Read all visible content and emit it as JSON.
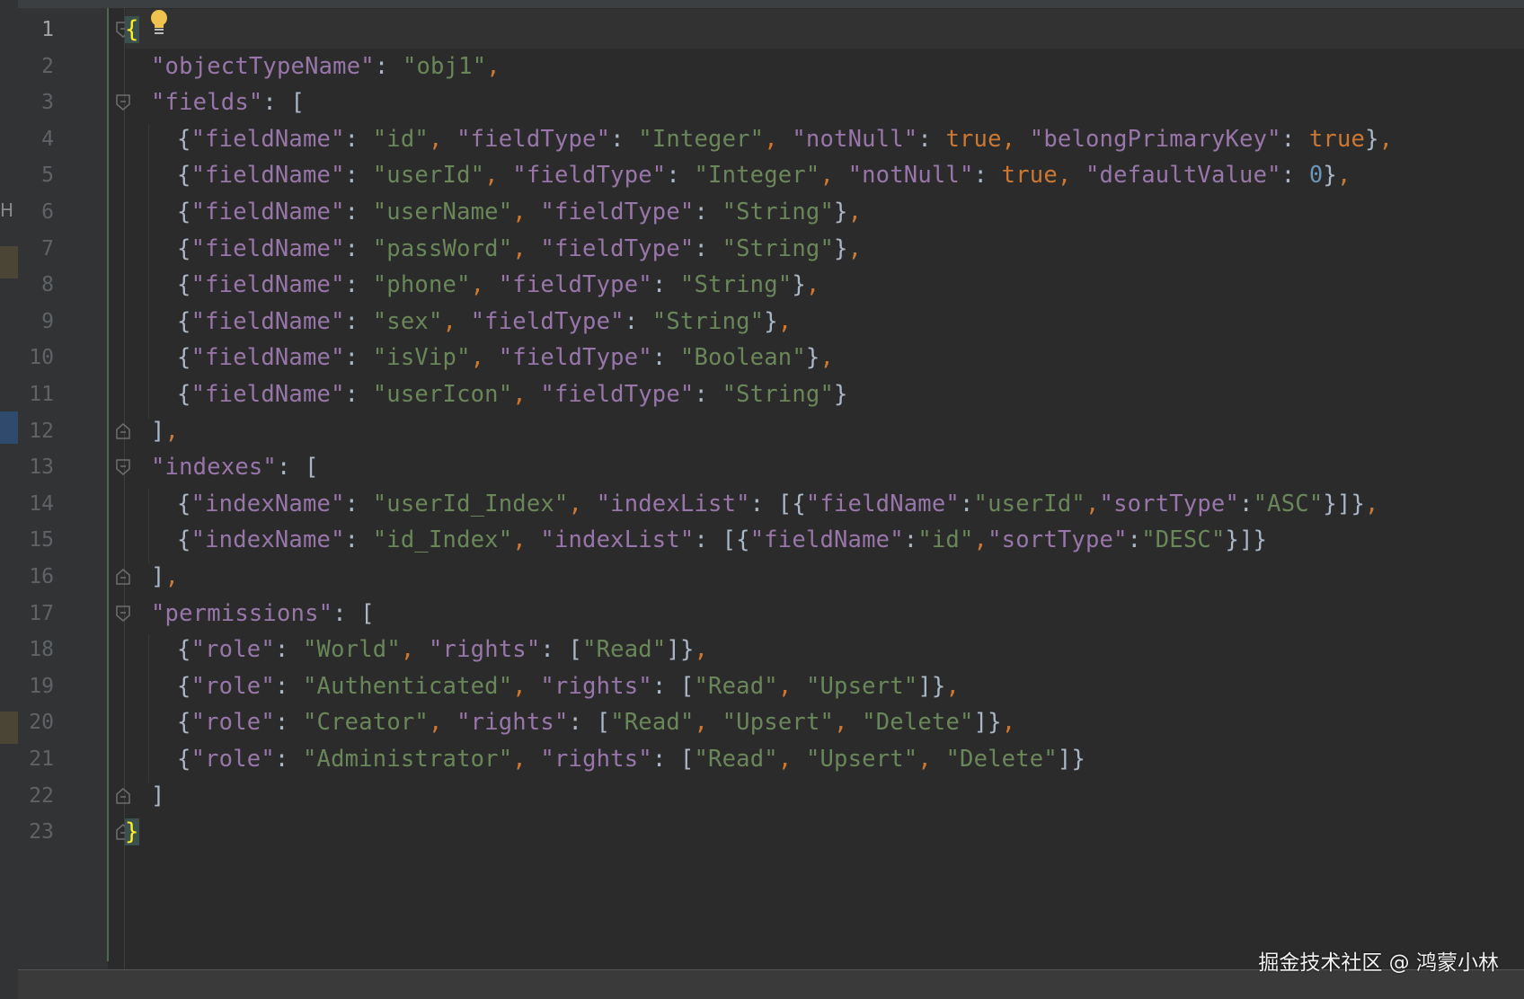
{
  "editor": {
    "language": "json",
    "active_line": 1,
    "side_strip_text": "H",
    "lines": [
      {
        "n": "1",
        "tokens": [
          {
            "t": "{",
            "c": "brace-hl"
          }
        ]
      },
      {
        "n": "2",
        "tokens": [
          {
            "t": "\"objectTypeName\"",
            "c": "key"
          },
          {
            "t": ": ",
            "c": "p"
          },
          {
            "t": "\"obj1\"",
            "c": "str"
          },
          {
            "t": ",",
            "c": "kw"
          }
        ]
      },
      {
        "n": "3",
        "tokens": [
          {
            "t": "\"fields\"",
            "c": "key"
          },
          {
            "t": ": [",
            "c": "p"
          }
        ]
      },
      {
        "n": "4",
        "tokens": [
          {
            "t": "{",
            "c": "p"
          },
          {
            "t": "\"fieldName\"",
            "c": "key"
          },
          {
            "t": ": ",
            "c": "p"
          },
          {
            "t": "\"id\"",
            "c": "str"
          },
          {
            "t": ", ",
            "c": "kw"
          },
          {
            "t": "\"fieldType\"",
            "c": "key"
          },
          {
            "t": ": ",
            "c": "p"
          },
          {
            "t": "\"Integer\"",
            "c": "str"
          },
          {
            "t": ", ",
            "c": "kw"
          },
          {
            "t": "\"notNull\"",
            "c": "key"
          },
          {
            "t": ": ",
            "c": "p"
          },
          {
            "t": "true",
            "c": "kw"
          },
          {
            "t": ", ",
            "c": "kw"
          },
          {
            "t": "\"belongPrimaryKey\"",
            "c": "key"
          },
          {
            "t": ": ",
            "c": "p"
          },
          {
            "t": "true",
            "c": "kw"
          },
          {
            "t": "}",
            "c": "p"
          },
          {
            "t": ",",
            "c": "kw"
          }
        ]
      },
      {
        "n": "5",
        "tokens": [
          {
            "t": "{",
            "c": "p"
          },
          {
            "t": "\"fieldName\"",
            "c": "key"
          },
          {
            "t": ": ",
            "c": "p"
          },
          {
            "t": "\"userId\"",
            "c": "str"
          },
          {
            "t": ", ",
            "c": "kw"
          },
          {
            "t": "\"fieldType\"",
            "c": "key"
          },
          {
            "t": ": ",
            "c": "p"
          },
          {
            "t": "\"Integer\"",
            "c": "str"
          },
          {
            "t": ", ",
            "c": "kw"
          },
          {
            "t": "\"notNull\"",
            "c": "key"
          },
          {
            "t": ": ",
            "c": "p"
          },
          {
            "t": "true",
            "c": "kw"
          },
          {
            "t": ", ",
            "c": "kw"
          },
          {
            "t": "\"defaultValue\"",
            "c": "key"
          },
          {
            "t": ": ",
            "c": "p"
          },
          {
            "t": "0",
            "c": "num"
          },
          {
            "t": "}",
            "c": "p"
          },
          {
            "t": ",",
            "c": "kw"
          }
        ]
      },
      {
        "n": "6",
        "tokens": [
          {
            "t": "{",
            "c": "p"
          },
          {
            "t": "\"fieldName\"",
            "c": "key"
          },
          {
            "t": ": ",
            "c": "p"
          },
          {
            "t": "\"userName\"",
            "c": "str"
          },
          {
            "t": ", ",
            "c": "kw"
          },
          {
            "t": "\"fieldType\"",
            "c": "key"
          },
          {
            "t": ": ",
            "c": "p"
          },
          {
            "t": "\"String\"",
            "c": "str"
          },
          {
            "t": "}",
            "c": "p"
          },
          {
            "t": ",",
            "c": "kw"
          }
        ]
      },
      {
        "n": "7",
        "tokens": [
          {
            "t": "{",
            "c": "p"
          },
          {
            "t": "\"fieldName\"",
            "c": "key"
          },
          {
            "t": ": ",
            "c": "p"
          },
          {
            "t": "\"passWord\"",
            "c": "str"
          },
          {
            "t": ", ",
            "c": "kw"
          },
          {
            "t": "\"fieldType\"",
            "c": "key"
          },
          {
            "t": ": ",
            "c": "p"
          },
          {
            "t": "\"String\"",
            "c": "str"
          },
          {
            "t": "}",
            "c": "p"
          },
          {
            "t": ",",
            "c": "kw"
          }
        ]
      },
      {
        "n": "8",
        "tokens": [
          {
            "t": "{",
            "c": "p"
          },
          {
            "t": "\"fieldName\"",
            "c": "key"
          },
          {
            "t": ": ",
            "c": "p"
          },
          {
            "t": "\"phone\"",
            "c": "str"
          },
          {
            "t": ", ",
            "c": "kw"
          },
          {
            "t": "\"fieldType\"",
            "c": "key"
          },
          {
            "t": ": ",
            "c": "p"
          },
          {
            "t": "\"String\"",
            "c": "str"
          },
          {
            "t": "}",
            "c": "p"
          },
          {
            "t": ",",
            "c": "kw"
          }
        ]
      },
      {
        "n": "9",
        "tokens": [
          {
            "t": "{",
            "c": "p"
          },
          {
            "t": "\"fieldName\"",
            "c": "key"
          },
          {
            "t": ": ",
            "c": "p"
          },
          {
            "t": "\"sex\"",
            "c": "str"
          },
          {
            "t": ", ",
            "c": "kw"
          },
          {
            "t": "\"fieldType\"",
            "c": "key"
          },
          {
            "t": ": ",
            "c": "p"
          },
          {
            "t": "\"String\"",
            "c": "str"
          },
          {
            "t": "}",
            "c": "p"
          },
          {
            "t": ",",
            "c": "kw"
          }
        ]
      },
      {
        "n": "10",
        "tokens": [
          {
            "t": "{",
            "c": "p"
          },
          {
            "t": "\"fieldName\"",
            "c": "key"
          },
          {
            "t": ": ",
            "c": "p"
          },
          {
            "t": "\"isVip\"",
            "c": "str"
          },
          {
            "t": ", ",
            "c": "kw"
          },
          {
            "t": "\"fieldType\"",
            "c": "key"
          },
          {
            "t": ": ",
            "c": "p"
          },
          {
            "t": "\"Boolean\"",
            "c": "str"
          },
          {
            "t": "}",
            "c": "p"
          },
          {
            "t": ",",
            "c": "kw"
          }
        ]
      },
      {
        "n": "11",
        "tokens": [
          {
            "t": "{",
            "c": "p"
          },
          {
            "t": "\"fieldName\"",
            "c": "key"
          },
          {
            "t": ": ",
            "c": "p"
          },
          {
            "t": "\"userIcon\"",
            "c": "str"
          },
          {
            "t": ", ",
            "c": "kw"
          },
          {
            "t": "\"fieldType\"",
            "c": "key"
          },
          {
            "t": ": ",
            "c": "p"
          },
          {
            "t": "\"String\"",
            "c": "str"
          },
          {
            "t": "}",
            "c": "p"
          }
        ]
      },
      {
        "n": "12",
        "tokens": [
          {
            "t": "]",
            "c": "p"
          },
          {
            "t": ",",
            "c": "kw"
          }
        ]
      },
      {
        "n": "13",
        "tokens": [
          {
            "t": "\"indexes\"",
            "c": "key"
          },
          {
            "t": ": [",
            "c": "p"
          }
        ]
      },
      {
        "n": "14",
        "tokens": [
          {
            "t": "{",
            "c": "p"
          },
          {
            "t": "\"indexName\"",
            "c": "key"
          },
          {
            "t": ": ",
            "c": "p"
          },
          {
            "t": "\"userId_Index\"",
            "c": "str"
          },
          {
            "t": ", ",
            "c": "kw"
          },
          {
            "t": "\"indexList\"",
            "c": "key"
          },
          {
            "t": ": [{",
            "c": "p"
          },
          {
            "t": "\"fieldName\"",
            "c": "key"
          },
          {
            "t": ":",
            "c": "p"
          },
          {
            "t": "\"userId\"",
            "c": "str"
          },
          {
            "t": ",",
            "c": "kw"
          },
          {
            "t": "\"sortType\"",
            "c": "key"
          },
          {
            "t": ":",
            "c": "p"
          },
          {
            "t": "\"ASC\"",
            "c": "str"
          },
          {
            "t": "}]}",
            "c": "p"
          },
          {
            "t": ",",
            "c": "kw"
          }
        ]
      },
      {
        "n": "15",
        "tokens": [
          {
            "t": "{",
            "c": "p"
          },
          {
            "t": "\"indexName\"",
            "c": "key"
          },
          {
            "t": ": ",
            "c": "p"
          },
          {
            "t": "\"id_Index\"",
            "c": "str"
          },
          {
            "t": ", ",
            "c": "kw"
          },
          {
            "t": "\"indexList\"",
            "c": "key"
          },
          {
            "t": ": [{",
            "c": "p"
          },
          {
            "t": "\"fieldName\"",
            "c": "key"
          },
          {
            "t": ":",
            "c": "p"
          },
          {
            "t": "\"id\"",
            "c": "str"
          },
          {
            "t": ",",
            "c": "kw"
          },
          {
            "t": "\"sortType\"",
            "c": "key"
          },
          {
            "t": ":",
            "c": "p"
          },
          {
            "t": "\"DESC\"",
            "c": "str"
          },
          {
            "t": "}]}",
            "c": "p"
          }
        ]
      },
      {
        "n": "16",
        "tokens": [
          {
            "t": "]",
            "c": "p"
          },
          {
            "t": ",",
            "c": "kw"
          }
        ]
      },
      {
        "n": "17",
        "tokens": [
          {
            "t": "\"permissions\"",
            "c": "key"
          },
          {
            "t": ": [",
            "c": "p"
          }
        ]
      },
      {
        "n": "18",
        "tokens": [
          {
            "t": "{",
            "c": "p"
          },
          {
            "t": "\"role\"",
            "c": "key"
          },
          {
            "t": ": ",
            "c": "p"
          },
          {
            "t": "\"World\"",
            "c": "str"
          },
          {
            "t": ", ",
            "c": "kw"
          },
          {
            "t": "\"rights\"",
            "c": "key"
          },
          {
            "t": ": [",
            "c": "p"
          },
          {
            "t": "\"Read\"",
            "c": "str"
          },
          {
            "t": "]}",
            "c": "p"
          },
          {
            "t": ",",
            "c": "kw"
          }
        ]
      },
      {
        "n": "19",
        "tokens": [
          {
            "t": "{",
            "c": "p"
          },
          {
            "t": "\"role\"",
            "c": "key"
          },
          {
            "t": ": ",
            "c": "p"
          },
          {
            "t": "\"Authenticated\"",
            "c": "str"
          },
          {
            "t": ", ",
            "c": "kw"
          },
          {
            "t": "\"rights\"",
            "c": "key"
          },
          {
            "t": ": [",
            "c": "p"
          },
          {
            "t": "\"Read\"",
            "c": "str"
          },
          {
            "t": ", ",
            "c": "kw"
          },
          {
            "t": "\"Upsert\"",
            "c": "str"
          },
          {
            "t": "]}",
            "c": "p"
          },
          {
            "t": ",",
            "c": "kw"
          }
        ]
      },
      {
        "n": "20",
        "tokens": [
          {
            "t": "{",
            "c": "p"
          },
          {
            "t": "\"role\"",
            "c": "key"
          },
          {
            "t": ": ",
            "c": "p"
          },
          {
            "t": "\"Creator\"",
            "c": "str"
          },
          {
            "t": ", ",
            "c": "kw"
          },
          {
            "t": "\"rights\"",
            "c": "key"
          },
          {
            "t": ": [",
            "c": "p"
          },
          {
            "t": "\"Read\"",
            "c": "str"
          },
          {
            "t": ", ",
            "c": "kw"
          },
          {
            "t": "\"Upsert\"",
            "c": "str"
          },
          {
            "t": ", ",
            "c": "kw"
          },
          {
            "t": "\"Delete\"",
            "c": "str"
          },
          {
            "t": "]}",
            "c": "p"
          },
          {
            "t": ",",
            "c": "kw"
          }
        ]
      },
      {
        "n": "21",
        "tokens": [
          {
            "t": "{",
            "c": "p"
          },
          {
            "t": "\"role\"",
            "c": "key"
          },
          {
            "t": ": ",
            "c": "p"
          },
          {
            "t": "\"Administrator\"",
            "c": "str"
          },
          {
            "t": ", ",
            "c": "kw"
          },
          {
            "t": "\"rights\"",
            "c": "key"
          },
          {
            "t": ": [",
            "c": "p"
          },
          {
            "t": "\"Read\"",
            "c": "str"
          },
          {
            "t": ", ",
            "c": "kw"
          },
          {
            "t": "\"Upsert\"",
            "c": "str"
          },
          {
            "t": ", ",
            "c": "kw"
          },
          {
            "t": "\"Delete\"",
            "c": "str"
          },
          {
            "t": "]}",
            "c": "p"
          }
        ]
      },
      {
        "n": "22",
        "tokens": [
          {
            "t": "]",
            "c": "p"
          }
        ]
      },
      {
        "n": "23",
        "tokens": [
          {
            "t": "}",
            "c": "brace-hl"
          }
        ]
      }
    ]
  },
  "watermark": "掘金技术社区 @ 鸿蒙小林",
  "colors": {
    "background": "#2b2b2b",
    "gutter": "#313335",
    "key": "#9876aa",
    "string": "#6a8759",
    "keyword": "#cc7832",
    "number": "#6897bb",
    "punctuation": "#a9b7c6",
    "line_number": "#606366",
    "brace_highlight": "#ffef28",
    "bulb": "#f0c24f"
  },
  "icons": {
    "fold_markers": "fold-arrow-icon",
    "intention": "lightbulb-icon"
  }
}
